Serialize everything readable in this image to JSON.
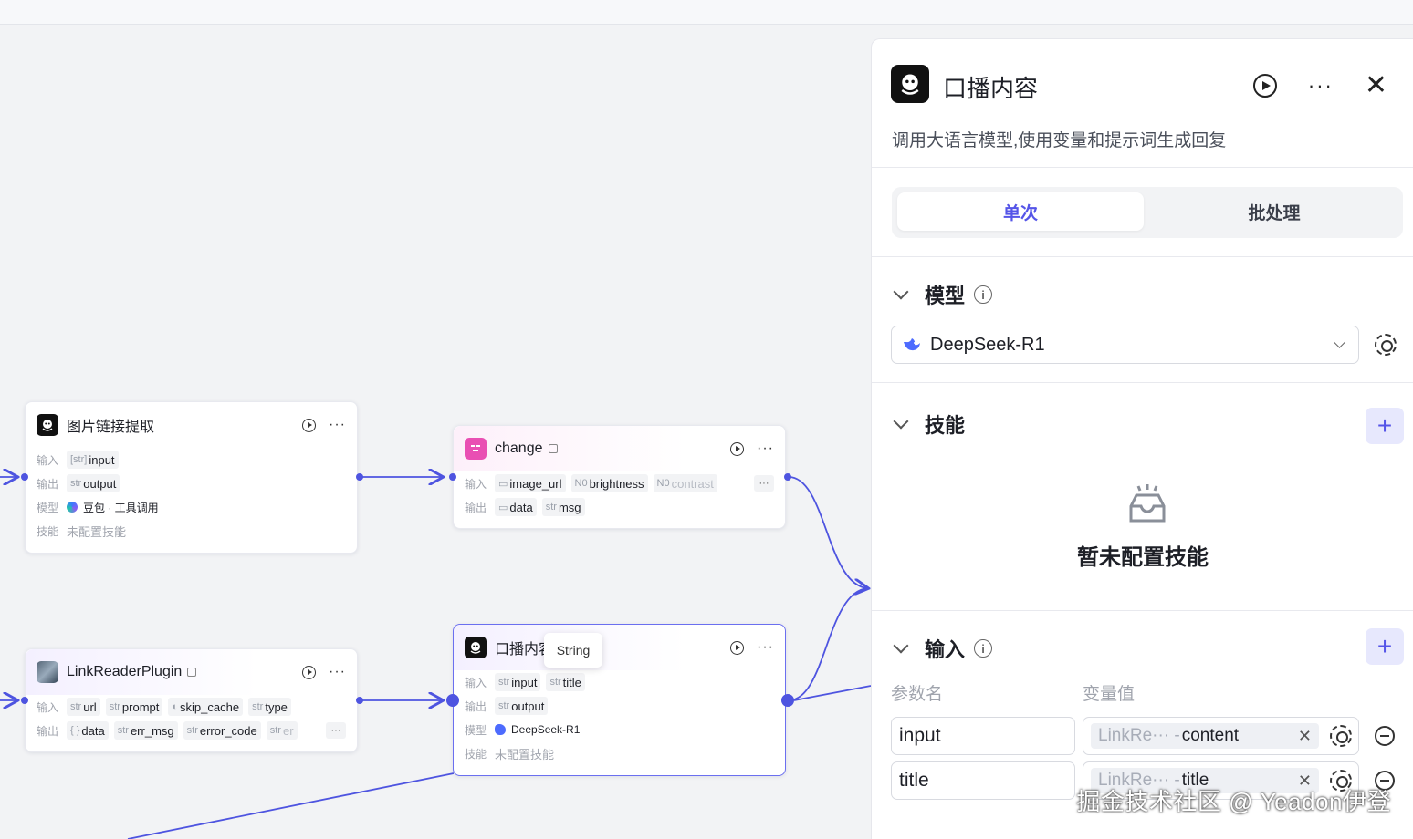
{
  "nodes": {
    "image_link": {
      "title": "图片链接提取",
      "input_label": "输入",
      "output_label": "输出",
      "model_label": "模型",
      "skill_label": "技能",
      "inputs": [
        {
          "type": "[str]",
          "name": "input"
        }
      ],
      "outputs": [
        {
          "type": "str",
          "name": "output"
        }
      ],
      "model": "豆包 · 工具调用",
      "skill": "未配置技能"
    },
    "change": {
      "title": "change",
      "input_label": "输入",
      "output_label": "输出",
      "inputs": [
        {
          "type": "img",
          "name": "image_url"
        },
        {
          "type": "N0",
          "name": "brightness"
        },
        {
          "type": "N0",
          "name": "contrast"
        }
      ],
      "outputs": [
        {
          "type": "img",
          "name": "data"
        },
        {
          "type": "str",
          "name": "msg"
        }
      ],
      "more": "···"
    },
    "link_reader": {
      "title": "LinkReaderPlugin",
      "input_label": "输入",
      "output_label": "输出",
      "inputs": [
        {
          "type": "str",
          "name": "url"
        },
        {
          "type": "str",
          "name": "prompt"
        },
        {
          "type": "bool",
          "name": "skip_cache"
        },
        {
          "type": "str",
          "name": "type"
        }
      ],
      "outputs": [
        {
          "type": "{ }",
          "name": "data"
        },
        {
          "type": "str",
          "name": "err_msg"
        },
        {
          "type": "str",
          "name": "error_code"
        },
        {
          "type": "str",
          "name": "er"
        }
      ],
      "more": "···"
    },
    "broadcast": {
      "title": "口播内容",
      "input_label": "输入",
      "output_label": "输出",
      "model_label": "模型",
      "skill_label": "技能",
      "inputs": [
        {
          "type": "str",
          "name": "input"
        },
        {
          "type": "str",
          "name": "title"
        }
      ],
      "outputs": [
        {
          "type": "str",
          "name": "output"
        }
      ],
      "model": "DeepSeek-R1",
      "skill": "未配置技能"
    },
    "tooltip": "String"
  },
  "panel": {
    "title": "口播内容",
    "description": "调用大语言模型,使用变量和提示词生成回复",
    "tabs": [
      "单次",
      "批处理"
    ],
    "model_section": "模型",
    "model_value": "DeepSeek-R1",
    "skill_section": "技能",
    "skill_empty": "暂未配置技能",
    "input_section": "输入",
    "col_param": "参数名",
    "col_value": "变量值",
    "params": [
      {
        "name": "input",
        "source": "LinkRe··· -",
        "var": "content"
      },
      {
        "name": "title",
        "source": "LinkRe··· -",
        "var": "title"
      }
    ]
  },
  "watermark": "掘金技术社区 @ Yeadon伊登",
  "colors": {
    "accent": "#5555e8",
    "edge": "#4e54e0"
  }
}
